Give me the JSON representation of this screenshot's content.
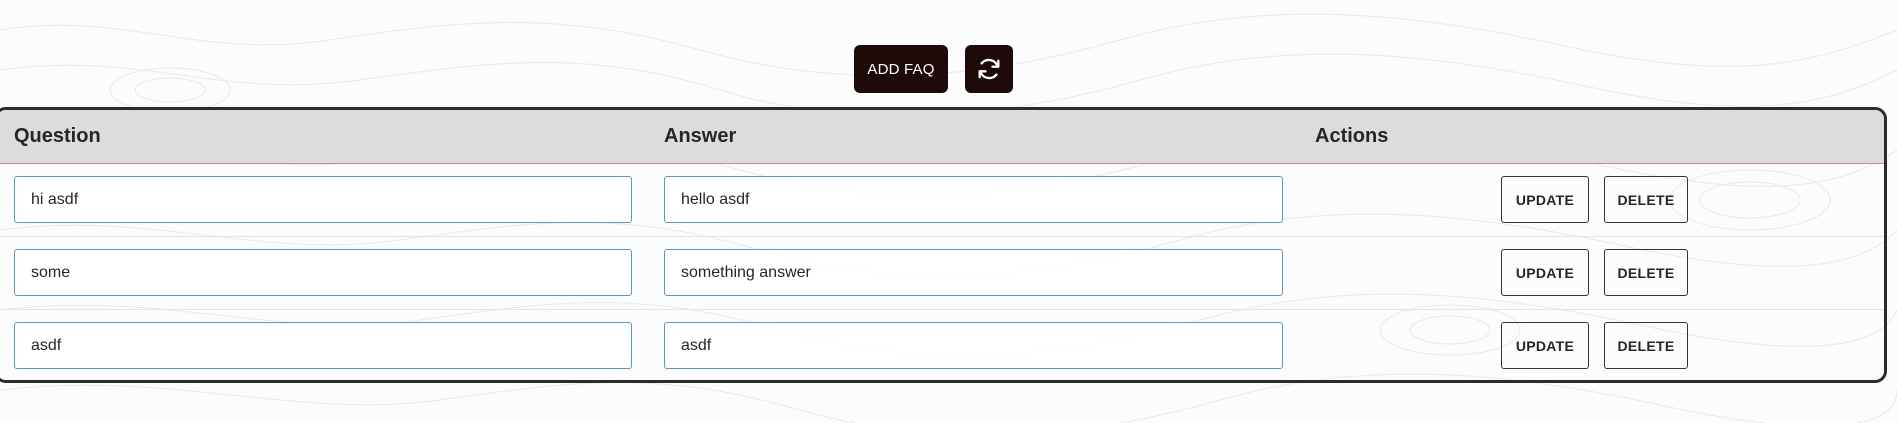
{
  "toolbar": {
    "add_label": "ADD FAQ",
    "refresh_icon": "refresh-icon"
  },
  "table": {
    "headers": {
      "question": "Question",
      "answer": "Answer",
      "actions": "Actions"
    },
    "rows": [
      {
        "question": "hi asdf",
        "answer": "hello asdf",
        "update": "UPDATE",
        "delete": "DELETE"
      },
      {
        "question": "some",
        "answer": "something answer",
        "update": "UPDATE",
        "delete": "DELETE"
      },
      {
        "question": "asdf",
        "answer": "asdf",
        "update": "UPDATE",
        "delete": "DELETE"
      }
    ]
  },
  "colors": {
    "button_dark": "#1f0a0a",
    "input_border": "#5a98de",
    "header_bg": "#dcdcdc"
  }
}
